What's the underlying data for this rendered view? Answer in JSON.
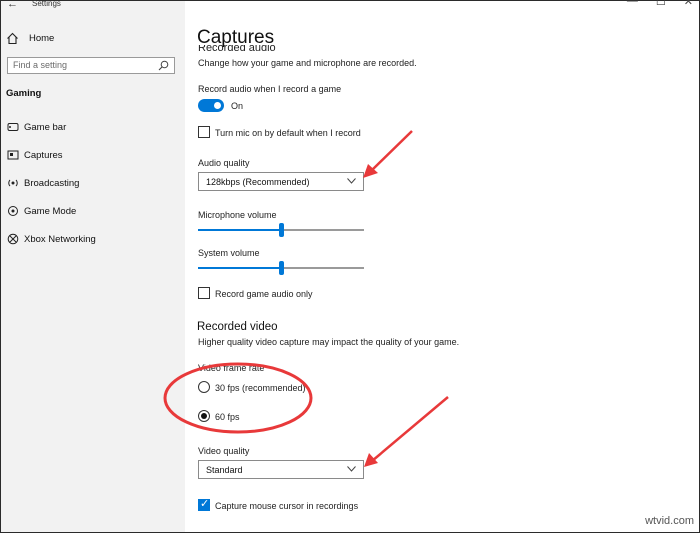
{
  "window": {
    "app_title": "Settings",
    "controls": [
      "—",
      "☐",
      "✕"
    ]
  },
  "sidebar": {
    "home_label": "Home",
    "search_placeholder": "Find a setting",
    "section_label": "Gaming",
    "items": [
      {
        "label": "Game bar",
        "icon": "game-bar-icon"
      },
      {
        "label": "Captures",
        "icon": "captures-icon"
      },
      {
        "label": "Broadcasting",
        "icon": "broadcasting-icon"
      },
      {
        "label": "Game Mode",
        "icon": "game-mode-icon"
      },
      {
        "label": "Xbox Networking",
        "icon": "xbox-icon"
      }
    ]
  },
  "main": {
    "title": "Captures",
    "recorded_audio_heading": "Recorded audio",
    "audio_description": "Change how your game and microphone are recorded.",
    "record_audio_label": "Record audio when I record a game",
    "record_audio_toggle": "On",
    "mic_default_label": "Turn mic on by default when I record",
    "audio_quality_label": "Audio quality",
    "audio_quality_value": "128kbps (Recommended)",
    "mic_volume_label": "Microphone volume",
    "mic_volume_level": 0.5,
    "system_volume_label": "System volume",
    "system_volume_level": 0.5,
    "game_audio_only_label": "Record game audio only",
    "recorded_video_heading": "Recorded video",
    "video_description": "Higher quality video capture may impact the quality of your game.",
    "frame_rate_label": "Video frame rate",
    "frame_rate_options": [
      "30 fps (recommended)",
      "60 fps"
    ],
    "frame_rate_selected": "60 fps",
    "video_quality_label": "Video quality",
    "video_quality_value": "Standard",
    "capture_cursor_label": "Capture mouse cursor in recordings",
    "capture_cursor_checked": true
  },
  "annotation_color": "#e8393a",
  "accent_color": "#0078d7",
  "watermark": "wtvid.com"
}
